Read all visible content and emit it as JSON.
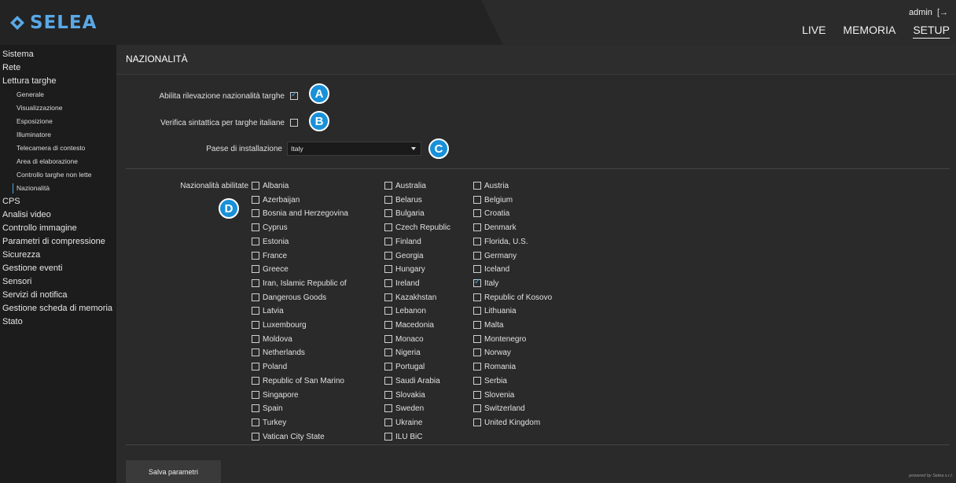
{
  "brand": {
    "name": "SELEA",
    "color": "#5aa8e6"
  },
  "user": {
    "name": "admin",
    "logout_icon": "logout-icon"
  },
  "topnav": [
    {
      "label": "LIVE",
      "active": false
    },
    {
      "label": "MEMORIA",
      "active": false
    },
    {
      "label": "SETUP",
      "active": true
    }
  ],
  "sidebar": {
    "items": [
      {
        "label": "Sistema",
        "level": 0
      },
      {
        "label": "Rete",
        "level": 0
      },
      {
        "label": "Lettura targhe",
        "level": 0
      },
      {
        "label": "Generale",
        "level": 1
      },
      {
        "label": "Visualizzazione",
        "level": 1
      },
      {
        "label": "Esposizione",
        "level": 1
      },
      {
        "label": "Illuminatore",
        "level": 1
      },
      {
        "label": "Telecamera di contesto",
        "level": 1
      },
      {
        "label": "Area di elaborazione",
        "level": 1
      },
      {
        "label": "Controllo targhe non lette",
        "level": 1
      },
      {
        "label": "Nazionalità",
        "level": 1,
        "active": true
      },
      {
        "label": "CPS",
        "level": 0
      },
      {
        "label": "Analisi video",
        "level": 0
      },
      {
        "label": "Controllo immagine",
        "level": 0
      },
      {
        "label": "Parametri di compressione",
        "level": 0
      },
      {
        "label": "Sicurezza",
        "level": 0
      },
      {
        "label": "Gestione eventi",
        "level": 0
      },
      {
        "label": "Sensori",
        "level": 0
      },
      {
        "label": "Servizi di notifica",
        "level": 0
      },
      {
        "label": "Gestione scheda di memoria",
        "level": 0
      },
      {
        "label": "Stato",
        "level": 0
      }
    ]
  },
  "page": {
    "title": "NAZIONALITÀ",
    "enable_label": "Abilita rilevazione nazionalità targhe",
    "enable_checked": true,
    "syntax_label": "Verifica sintattica per targhe italiane",
    "syntax_checked": false,
    "country_label": "Paese di installazione",
    "country_value": "Italy",
    "nationalities_label": "Nazionalità abilitate",
    "save_label": "Salva parametri",
    "powered": "powered by Selea s.r.l."
  },
  "markers": [
    "A",
    "B",
    "C",
    "D"
  ],
  "nationalities": {
    "col1": [
      {
        "name": "Albania",
        "checked": false
      },
      {
        "name": "Azerbaijan",
        "checked": false
      },
      {
        "name": "Bosnia and Herzegovina",
        "checked": false
      },
      {
        "name": "Cyprus",
        "checked": false
      },
      {
        "name": "Estonia",
        "checked": false
      },
      {
        "name": "France",
        "checked": false
      },
      {
        "name": "Greece",
        "checked": false
      },
      {
        "name": "Iran, Islamic Republic of",
        "checked": false
      },
      {
        "name": "Dangerous Goods",
        "checked": false
      },
      {
        "name": "Latvia",
        "checked": false
      },
      {
        "name": "Luxembourg",
        "checked": false
      },
      {
        "name": "Moldova",
        "checked": false
      },
      {
        "name": "Netherlands",
        "checked": false
      },
      {
        "name": "Poland",
        "checked": false
      },
      {
        "name": "Republic of San Marino",
        "checked": false
      },
      {
        "name": "Singapore",
        "checked": false
      },
      {
        "name": "Spain",
        "checked": false
      },
      {
        "name": "Turkey",
        "checked": false
      },
      {
        "name": "Vatican City State",
        "checked": false
      }
    ],
    "col2": [
      {
        "name": "Australia",
        "checked": false
      },
      {
        "name": "Belarus",
        "checked": false
      },
      {
        "name": "Bulgaria",
        "checked": false
      },
      {
        "name": "Czech Republic",
        "checked": false
      },
      {
        "name": "Finland",
        "checked": false
      },
      {
        "name": "Georgia",
        "checked": false
      },
      {
        "name": "Hungary",
        "checked": false
      },
      {
        "name": "Ireland",
        "checked": false
      },
      {
        "name": "Kazakhstan",
        "checked": false
      },
      {
        "name": "Lebanon",
        "checked": false
      },
      {
        "name": "Macedonia",
        "checked": false
      },
      {
        "name": "Monaco",
        "checked": false
      },
      {
        "name": "Nigeria",
        "checked": false
      },
      {
        "name": "Portugal",
        "checked": false
      },
      {
        "name": "Saudi Arabia",
        "checked": false
      },
      {
        "name": "Slovakia",
        "checked": false
      },
      {
        "name": "Sweden",
        "checked": false
      },
      {
        "name": "Ukraine",
        "checked": false
      },
      {
        "name": "ILU BiC",
        "checked": false
      }
    ],
    "col3": [
      {
        "name": "Austria",
        "checked": false
      },
      {
        "name": "Belgium",
        "checked": false
      },
      {
        "name": "Croatia",
        "checked": false
      },
      {
        "name": "Denmark",
        "checked": false
      },
      {
        "name": "Florida, U.S.",
        "checked": false
      },
      {
        "name": "Germany",
        "checked": false
      },
      {
        "name": "Iceland",
        "checked": false
      },
      {
        "name": "Italy",
        "checked": true
      },
      {
        "name": "Republic of Kosovo",
        "checked": false
      },
      {
        "name": "Lithuania",
        "checked": false
      },
      {
        "name": "Malta",
        "checked": false
      },
      {
        "name": "Montenegro",
        "checked": false
      },
      {
        "name": "Norway",
        "checked": false
      },
      {
        "name": "Romania",
        "checked": false
      },
      {
        "name": "Serbia",
        "checked": false
      },
      {
        "name": "Slovenia",
        "checked": false
      },
      {
        "name": "Switzerland",
        "checked": false
      },
      {
        "name": "United Kingdom",
        "checked": false
      }
    ]
  },
  "colors": {
    "accent": "#1990d8",
    "check": "#4aa3e0",
    "background": "#2a2a2a"
  }
}
